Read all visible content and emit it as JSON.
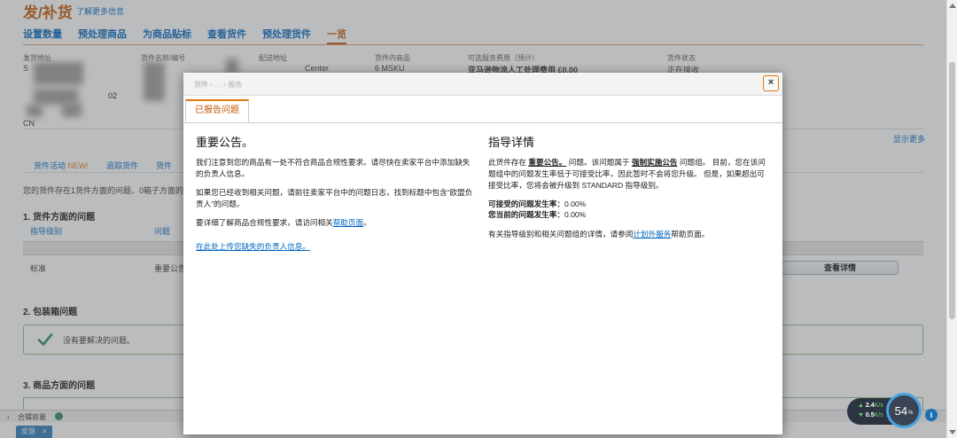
{
  "page": {
    "title": "发/补货",
    "learn_more": "了解更多信息",
    "steps": [
      "设置数量",
      "预处理商品",
      "为商品贴标",
      "查看货件",
      "预处理货件",
      "一览"
    ],
    "summary_cols": [
      "发货地址",
      "货件名称/编号",
      "配送地址",
      "货件内商品",
      "可选服务费用（预计）",
      "货件状态"
    ],
    "summary_vals": {
      "s": "S",
      "goods": "6 MSKU",
      "fee": "亚马逊物流人工处理费用 £0.00",
      "status": "正在接收",
      "center": "Center"
    },
    "num_02": "02",
    "cn": "CN",
    "show_more": "显示更多",
    "sub_tabs": {
      "activity": "货件活动",
      "new_badge": "NEW!",
      "track": "追踪货件",
      "third": "货件"
    },
    "note": "您的货件存在1货件方面的问题、0箱子方面的问题",
    "section1": "1. 货件方面的问题",
    "th_level": "指导级别",
    "th_issue": "问题",
    "row_level": "标准",
    "row_issue": "重要公告",
    "view_detail": "查看详情",
    "section2": "2. 包装箱问题",
    "ok_text": "没有要解决的问题。",
    "section3": "3. 商品方面的问题",
    "bottom_label": "合辑容量",
    "feedback": "反馈",
    "feedback_close": "×",
    "speed_up": "2.4",
    "speed_down": "0.5",
    "speed_unit": "K/s",
    "speed_percent": "54",
    "speed_percent_unit": "%",
    "info_badge": "i"
  },
  "modal": {
    "crumbs": "货件 › … › 报告",
    "close": "×",
    "tab": "已报告问题",
    "left": {
      "title": "重要公告。",
      "p1": "我们注意到您的商品有一处不符合商品合规性要求。请尽快在卖家平台中添加缺失的负责人信息。",
      "p2": "如果您已经收到相关问题，请前往卖家平台中的问题日志，找到标题中包含“欧盟负责人”的问题。",
      "p3_prefix": "要详细了解商品合规性要求，请访问相关",
      "p3_link": "帮助页面",
      "p3_suffix": "。",
      "upload_link": "在此处上传您缺失的负责人信息。"
    },
    "right": {
      "title": "指导详情",
      "p1_a": "此货件存在",
      "p1_b": "重要公告。",
      "p1_c": "问题。该问题属于",
      "p1_d": "强制实施公告",
      "p1_e": "问题组。 目前，您在该问题组中的问题发生率低于可接受比率，因此暂时不会将您升级。 但是，如果超出可接受比率，您将会被升级到 STANDARD 指导级别。",
      "acceptable_label": "可接受的问题发生率：",
      "acceptable_value": "0.00%",
      "current_label": "您当前的问题发生率：",
      "current_value": "0.00%",
      "p3_prefix": "有关指导级别和相关问题组的详情，请参阅",
      "p3_link": "计划外服务",
      "p3_suffix": "帮助页面。"
    }
  },
  "colors": {
    "accent": "#e47911",
    "link": "#0066c0",
    "ok_green": "#2e8b57"
  },
  "icons": {
    "close": "close-icon",
    "check": "checkmark-icon",
    "info": "info-icon"
  }
}
